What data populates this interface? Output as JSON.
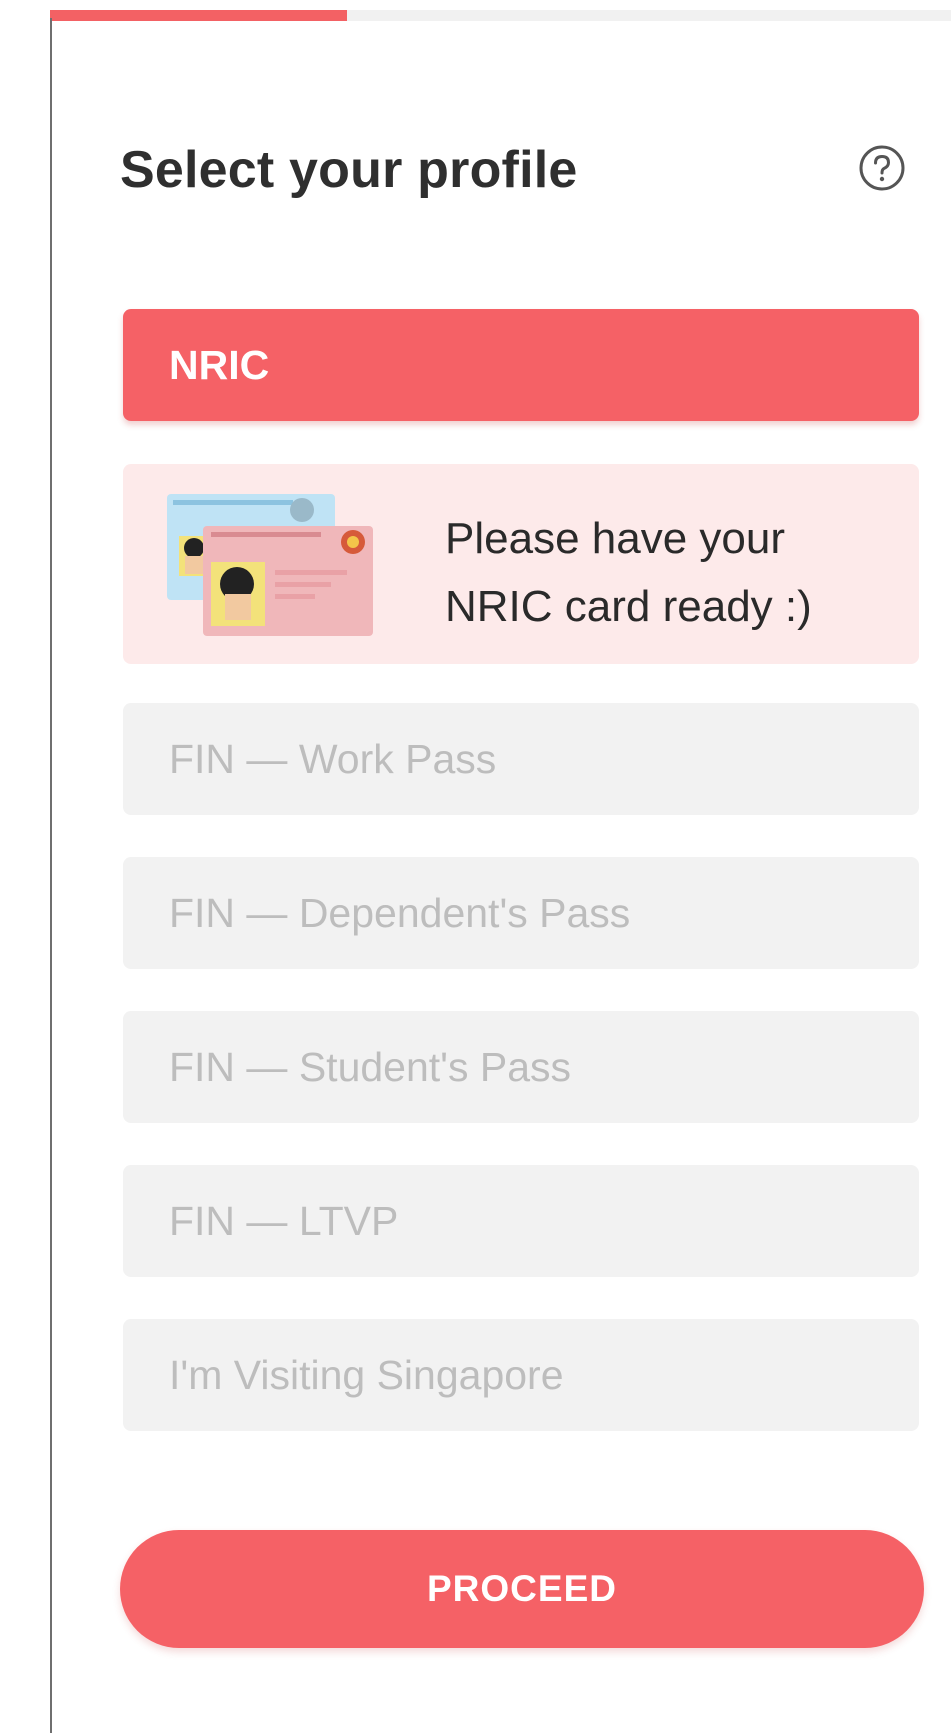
{
  "progress": {
    "fraction": 0.33,
    "fill_color": "#f36164"
  },
  "header": {
    "title": "Select your profile",
    "help_icon": "help-circle-icon"
  },
  "profiles": {
    "selected": "NRIC",
    "options": [
      {
        "label": "NRIC",
        "selected": true
      },
      {
        "label": "FIN — Work Pass",
        "selected": false
      },
      {
        "label": "FIN — Dependent's Pass",
        "selected": false
      },
      {
        "label": "FIN — Student's Pass",
        "selected": false
      },
      {
        "label": "FIN — LTVP",
        "selected": false
      },
      {
        "label": "I'm Visiting Singapore",
        "selected": false
      }
    ]
  },
  "info": {
    "line1": "Please have your",
    "line2": "NRIC card ready :)",
    "illustration": "nric-cards-illustration"
  },
  "actions": {
    "proceed_label": "PROCEED"
  },
  "colors": {
    "accent": "#f56166",
    "info_bg": "#fdeaea",
    "option_bg": "#f2f2f2",
    "option_text": "#bdbdbd"
  }
}
